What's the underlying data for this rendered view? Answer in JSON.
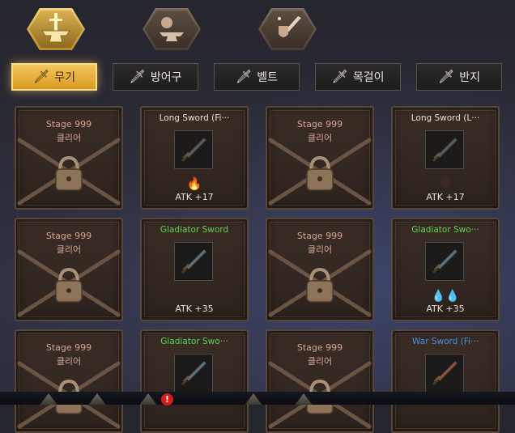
{
  "category_bar": {
    "categories": [
      {
        "icon": "sword-anvil-icon",
        "active": true
      },
      {
        "icon": "anvil-bag-icon",
        "active": false
      },
      {
        "icon": "sword-shield-icon",
        "active": false
      }
    ]
  },
  "tabs": [
    {
      "label": "무기",
      "icon": "sword-icon",
      "active": true
    },
    {
      "label": "방어구",
      "icon": "sword-icon",
      "active": false
    },
    {
      "label": "벨트",
      "icon": "sword-icon",
      "active": false
    },
    {
      "label": "목걸이",
      "icon": "sword-icon",
      "active": false
    },
    {
      "label": "반지",
      "icon": "sword-icon",
      "active": false
    }
  ],
  "grid": {
    "cards": [
      {
        "locked": true,
        "stage_label": "Stage 999",
        "clear_label": "클리어"
      },
      {
        "locked": false,
        "name": "Long Sword (Fi···",
        "name_color": "#e8e0d6",
        "gem": "red-flame",
        "atk": "ATK +17",
        "blade_color": "#5a5a5a"
      },
      {
        "locked": true,
        "stage_label": "Stage 999",
        "clear_label": "클리어"
      },
      {
        "locked": false,
        "name": "Long Sword (L···",
        "name_color": "#e8e0d6",
        "gem": "brown-orb",
        "atk": "ATK +17",
        "blade_color": "#5a5a5a"
      },
      {
        "locked": true,
        "stage_label": "Stage 999",
        "clear_label": "클리어"
      },
      {
        "locked": false,
        "name": "Gladiator Sword",
        "name_color": "#5ed34a",
        "gem": "",
        "atk": "ATK +35",
        "blade_color": "#5b6f7a"
      },
      {
        "locked": true,
        "stage_label": "Stage 999",
        "clear_label": "클리어"
      },
      {
        "locked": false,
        "name": "Gladiator Swo···",
        "name_color": "#5ed34a",
        "gem": "blue-drops",
        "atk": "ATK +35",
        "blade_color": "#5b6f7a"
      },
      {
        "locked": true,
        "stage_label": "Stage 999",
        "clear_label": "클리어"
      },
      {
        "locked": false,
        "name": "Gladiator Swo···",
        "name_color": "#5ed34a",
        "gem": "",
        "atk": "",
        "blade_color": "#5b6f7a"
      },
      {
        "locked": true,
        "stage_label": "Stage 999",
        "clear_label": "클리어"
      },
      {
        "locked": false,
        "name": "War Sword (Fi···",
        "name_color": "#4a8ee0",
        "gem": "",
        "atk": "",
        "blade_color": "#8a5040"
      }
    ]
  },
  "bottom_bar": {
    "alert_badge": "!"
  }
}
